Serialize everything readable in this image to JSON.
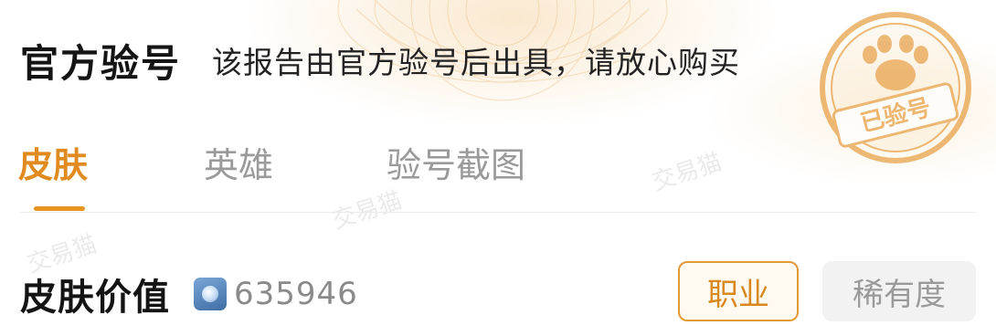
{
  "header": {
    "title": "官方验号",
    "subtitle": "该报告由官方验号后出具，请放心购买"
  },
  "seal": {
    "text": "已验号",
    "icon": "paw-icon",
    "color": "#e8a24a"
  },
  "tabs": [
    {
      "label": "皮肤",
      "active": true
    },
    {
      "label": "英雄",
      "active": false
    },
    {
      "label": "验号截图",
      "active": false
    }
  ],
  "watermark": "交易猫",
  "skin_value": {
    "label": "皮肤价值",
    "icon": "coin-icon",
    "amount": "635946"
  },
  "filters": {
    "job_label": "职业",
    "rarity_label": "稀有度"
  },
  "colors": {
    "accent": "#e08a1f",
    "muted": "#9a9a9a",
    "text": "#141414"
  }
}
